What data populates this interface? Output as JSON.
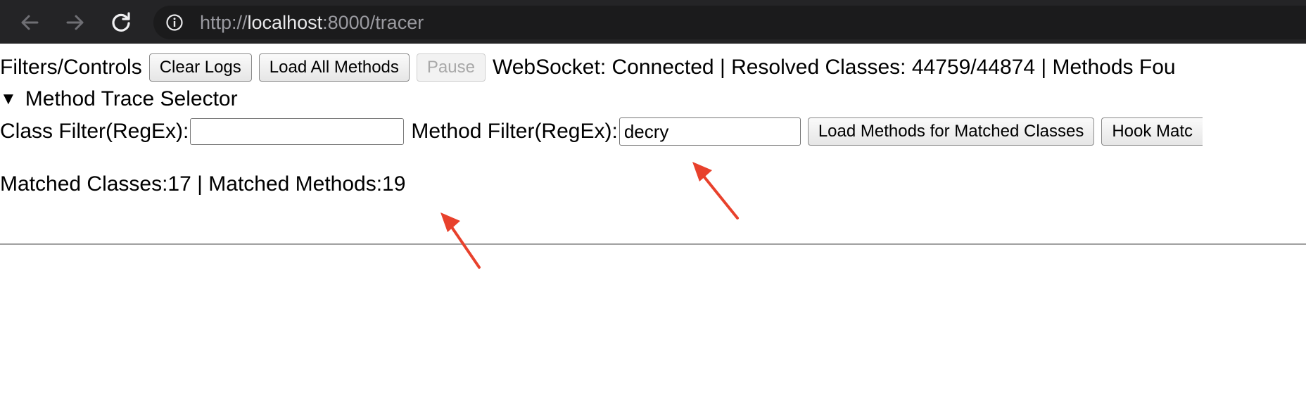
{
  "browser": {
    "url_scheme": "http://",
    "url_host": "localhost",
    "url_rest": ":8000/tracer"
  },
  "controls": {
    "title": "Filters/Controls",
    "clear_logs_label": "Clear Logs",
    "load_all_label": "Load All Methods",
    "pause_label": "Pause",
    "status": "WebSocket: Connected | Resolved Classes: 44759/44874 | Methods Fou"
  },
  "selector": {
    "summary": "Method Trace Selector"
  },
  "filters": {
    "class_label": "Class Filter(RegEx):",
    "class_value": "",
    "method_label": "Method Filter(RegEx):",
    "method_value": "decry",
    "load_matched_label": "Load Methods for Matched Classes",
    "hook_matched_label": "Hook Matc"
  },
  "matched": {
    "text": "Matched Classes:17 | Matched Methods:19"
  },
  "colors": {
    "annotation_arrow": "#e8412c",
    "browser_bar": "#242426"
  }
}
